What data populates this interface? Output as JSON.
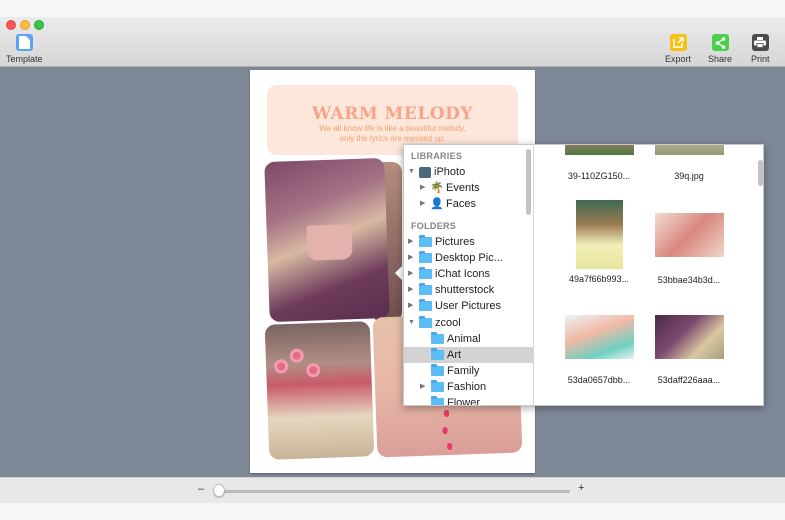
{
  "window": {
    "traffic_lights": [
      "close",
      "minimize",
      "zoom"
    ]
  },
  "toolbar": {
    "template_label": "Template",
    "export_label": "Export",
    "share_label": "Share",
    "print_label": "Print",
    "colors": {
      "template": "#5ba3f5",
      "export": "#f5c211",
      "share": "#4cd04c",
      "print": "#4a4a4a"
    }
  },
  "page": {
    "title": "WARM MELODY",
    "subtitle_line1": "We all know life is like a beautiful melody,",
    "subtitle_line2": "only the lyrics are messed up.",
    "title_color": "#f7a48b"
  },
  "media_browser": {
    "libraries_header": "LIBRARIES",
    "folders_header": "FOLDERS",
    "libraries": [
      {
        "label": "iPhoto",
        "expanded": true,
        "icon": "iphoto-icon"
      },
      {
        "label": "Events",
        "icon": "palm-tree-icon",
        "expanded": false
      },
      {
        "label": "Faces",
        "icon": "person-icon",
        "expanded": false
      }
    ],
    "folders": [
      {
        "label": "Pictures",
        "level": 0,
        "disclosure": "collapsed"
      },
      {
        "label": "Desktop Pic...",
        "level": 0,
        "disclosure": "collapsed"
      },
      {
        "label": "iChat Icons",
        "level": 0,
        "disclosure": "collapsed"
      },
      {
        "label": "shutterstock",
        "level": 0,
        "disclosure": "collapsed"
      },
      {
        "label": "User Pictures",
        "level": 0,
        "disclosure": "collapsed"
      },
      {
        "label": "zcool",
        "level": 0,
        "disclosure": "expanded"
      },
      {
        "label": "Animal",
        "level": 1,
        "disclosure": "none"
      },
      {
        "label": "Art",
        "level": 1,
        "disclosure": "none",
        "selected": true
      },
      {
        "label": "Family",
        "level": 1,
        "disclosure": "none"
      },
      {
        "label": "Fashion",
        "level": 1,
        "disclosure": "collapsed"
      },
      {
        "label": "Flower",
        "level": 1,
        "disclosure": "none"
      }
    ],
    "thumbnails": [
      {
        "label": "39-110ZG150..."
      },
      {
        "label": "39q.jpg"
      },
      {
        "label": "49a7f66b993..."
      },
      {
        "label": "53bbae34b3d..."
      },
      {
        "label": "53da0657dbb..."
      },
      {
        "label": "53daff226aaa..."
      }
    ]
  },
  "zoom_control": {
    "minus_label": "–",
    "plus_label": "+",
    "value_fraction": 0.0
  }
}
